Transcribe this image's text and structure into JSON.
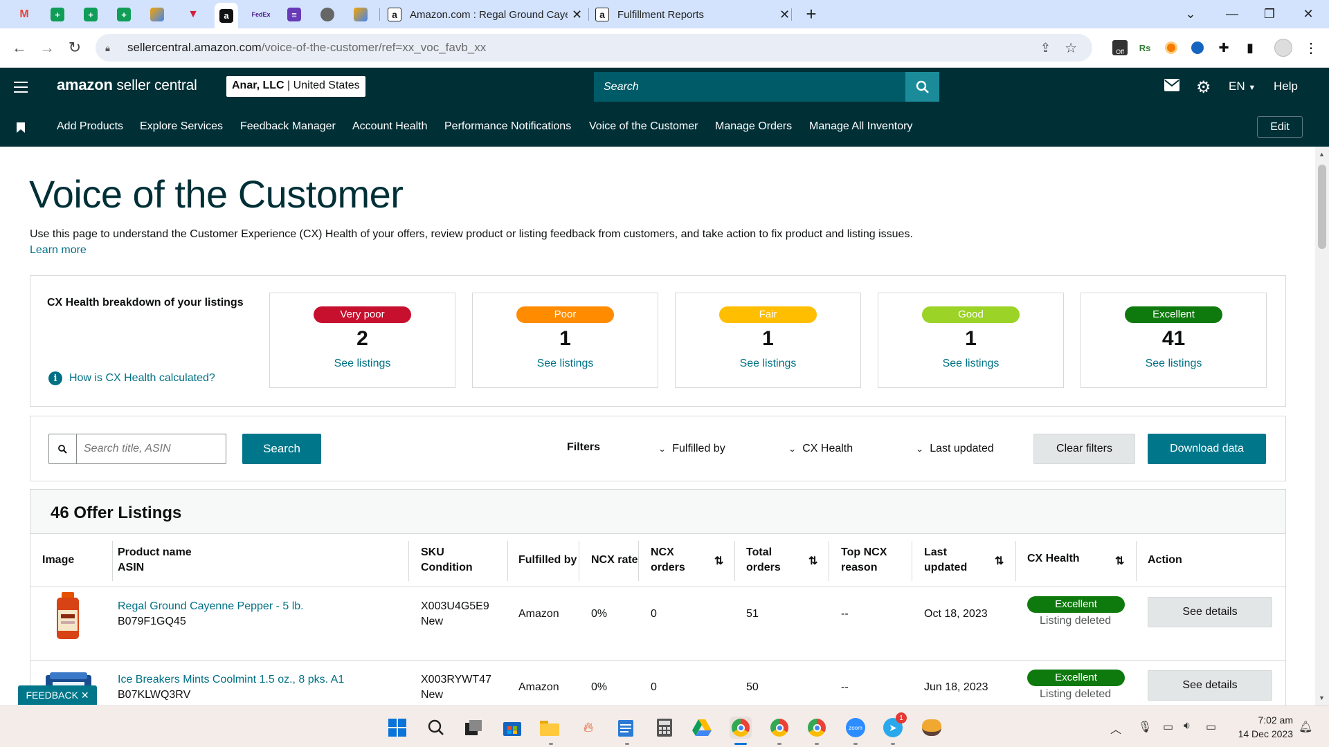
{
  "browser": {
    "tabs": [
      {
        "title": "Amazon.com : Regal Ground Cayenne Pepper",
        "favicon": "amazon-icon"
      },
      {
        "title": "Fulfillment Reports",
        "favicon": "amazon-icon"
      }
    ],
    "pinned_tabs": [
      "gmail-icon",
      "sheets-icon",
      "sheets-icon",
      "sheets-icon",
      "stack-icon",
      "flag-icon",
      "amazon-icon",
      "fedex-icon",
      "forms-icon",
      "globe-icon",
      "stack-icon"
    ],
    "new_tab": "+",
    "url_host": "sellercentral.amazon.com",
    "url_path": "/voice-of-the-customer/ref=xx_voc_favb_xx"
  },
  "header": {
    "logo_bold": "amazon",
    "logo_rest": " seller central",
    "account_name": "Anar, LLC",
    "account_sep": " | ",
    "account_region": "United States",
    "search_placeholder": "Search",
    "lang": "EN",
    "help": "Help"
  },
  "nav": {
    "items": [
      "Add Products",
      "Explore Services",
      "Feedback Manager",
      "Account Health",
      "Performance Notifications",
      "Voice of the Customer",
      "Manage Orders",
      "Manage All Inventory"
    ],
    "edit": "Edit"
  },
  "page": {
    "title": "Voice of the Customer",
    "description": "Use this page to understand the Customer Experience (CX) Health of your offers, review product or listing feedback from customers, and take action to fix product and listing issues.",
    "learn_more": "Learn more"
  },
  "cx_health": {
    "label": "CX Health breakdown of your listings",
    "how_link": "How is CX Health calculated?",
    "cards": [
      {
        "label": "Very poor",
        "count": "2",
        "link": "See listings",
        "color": "#c7102e"
      },
      {
        "label": "Poor",
        "count": "1",
        "link": "See listings",
        "color": "#ff8c00"
      },
      {
        "label": "Fair",
        "count": "1",
        "link": "See listings",
        "color": "#ffbe00"
      },
      {
        "label": "Good",
        "count": "1",
        "link": "See listings",
        "color": "#9bd326"
      },
      {
        "label": "Excellent",
        "count": "41",
        "link": "See listings",
        "color": "#0e7a0d"
      }
    ]
  },
  "filters": {
    "search_placeholder": "Search title, ASIN",
    "search_button": "Search",
    "label": "Filters",
    "dropdowns": [
      "Fulfilled by",
      "CX Health",
      "Last updated"
    ],
    "clear": "Clear filters",
    "download": "Download data"
  },
  "listings": {
    "heading": "46 Offer Listings",
    "columns": {
      "image": "Image",
      "product_name": "Product name",
      "asin": "ASIN",
      "sku": "SKU",
      "condition": "Condition",
      "fulfilled_by": "Fulfilled by",
      "ncx_rate": "NCX rate",
      "ncx_orders_1": "NCX",
      "ncx_orders_2": "orders",
      "total_orders_1": "Total",
      "total_orders_2": "orders",
      "top_ncx_1": "Top NCX",
      "top_ncx_2": "reason",
      "last_updated_1": "Last",
      "last_updated_2": "updated",
      "cx_health": "CX Health",
      "action": "Action"
    },
    "rows": [
      {
        "product": "Regal Ground Cayenne Pepper - 5 lb.",
        "asin": "B079F1GQ45",
        "sku": "X003U4G5E9",
        "condition": "New",
        "fulfilled_by": "Amazon",
        "ncx_rate": "0%",
        "ncx_orders": "0",
        "total_orders": "51",
        "top_reason": "--",
        "last_updated": "Oct 18, 2023",
        "cx_health": "Excellent",
        "status": "Listing deleted",
        "action": "See details"
      },
      {
        "product": "Ice Breakers Mints Coolmint 1.5 oz., 8 pks. A1",
        "asin": "B07KLWQ3RV",
        "sku": "X003RYWT47",
        "condition": "New",
        "fulfilled_by": "Amazon",
        "ncx_rate": "0%",
        "ncx_orders": "0",
        "total_orders": "50",
        "top_reason": "--",
        "last_updated": "Jun 18, 2023",
        "cx_health": "Excellent",
        "status": "Listing deleted",
        "action": "See details"
      }
    ]
  },
  "feedback": {
    "label": "FEEDBACK",
    "close": "✕"
  },
  "taskbar": {
    "icons": [
      "windows-icon",
      "search-icon",
      "task-view-icon",
      "store-icon",
      "file-explorer-icon",
      "flame-icon",
      "notepad-icon",
      "calculator-icon",
      "drive-icon",
      "chrome-icon",
      "chrome-icon",
      "chrome-icon",
      "zoom-icon",
      "telegram-icon",
      "cat-icon"
    ],
    "telegram_badge": "1",
    "time": "7:02 am",
    "date": "14 Dec 2023"
  }
}
